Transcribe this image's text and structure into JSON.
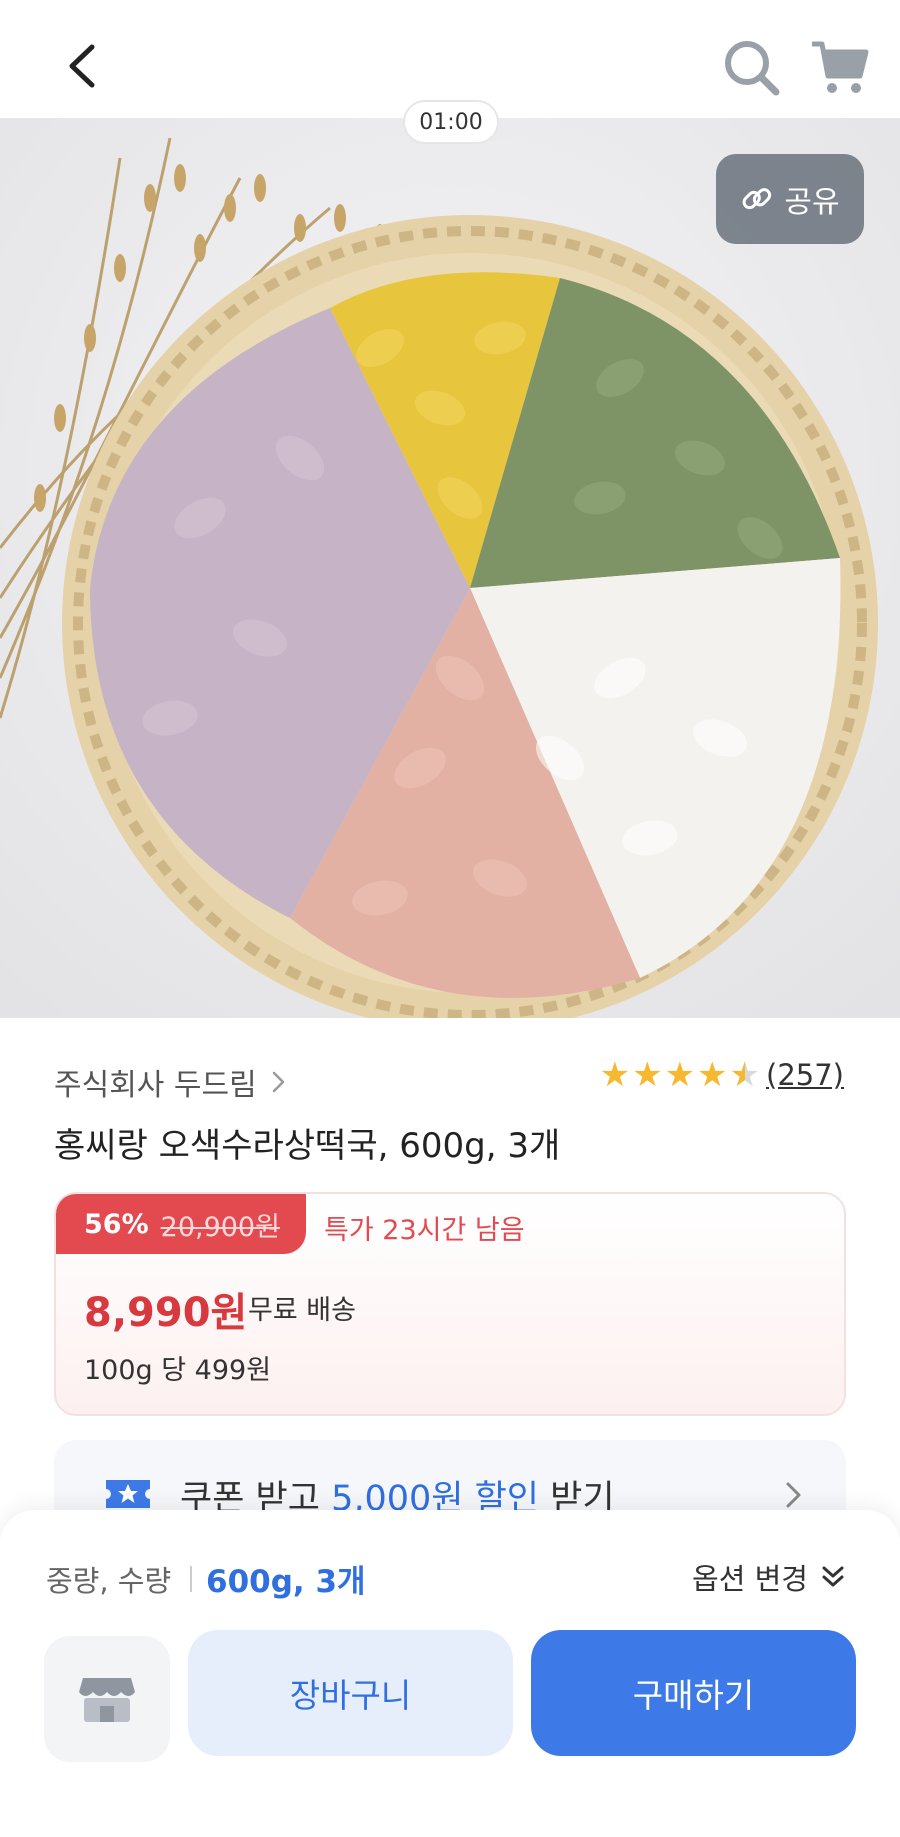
{
  "header": {
    "back_icon": "chevron-left-icon",
    "search_icon": "search-icon",
    "cart_icon": "cart-icon"
  },
  "hero": {
    "timer": "01:00",
    "share_label": "공유",
    "share_icon": "link-icon"
  },
  "product": {
    "seller": "주식회사 두드림",
    "rating": 4.5,
    "review_count": "(257)",
    "title": "홍씨랑 오색수라상떡국, 600g, 3개"
  },
  "price": {
    "discount_pct": "56%",
    "original_price": "20,900원",
    "special_text": "특가 23시간 남음",
    "sale_price": "8,990원",
    "shipping": "무료 배송",
    "unit_price": "100g 당 499원"
  },
  "coupon": {
    "text_before": "쿠폰 받고 ",
    "text_accent": "5,000원 할인",
    "text_after": " 받기"
  },
  "options": {
    "label": "중량, 수량",
    "value": "600g, 3개",
    "change_label": "옵션 변경"
  },
  "actions": {
    "cart_label": "장바구니",
    "buy_label": "구매하기"
  },
  "colors": {
    "accent_blue": "#3d7ae8",
    "sale_red": "#e24a4f",
    "star_yellow": "#f5b82e"
  }
}
